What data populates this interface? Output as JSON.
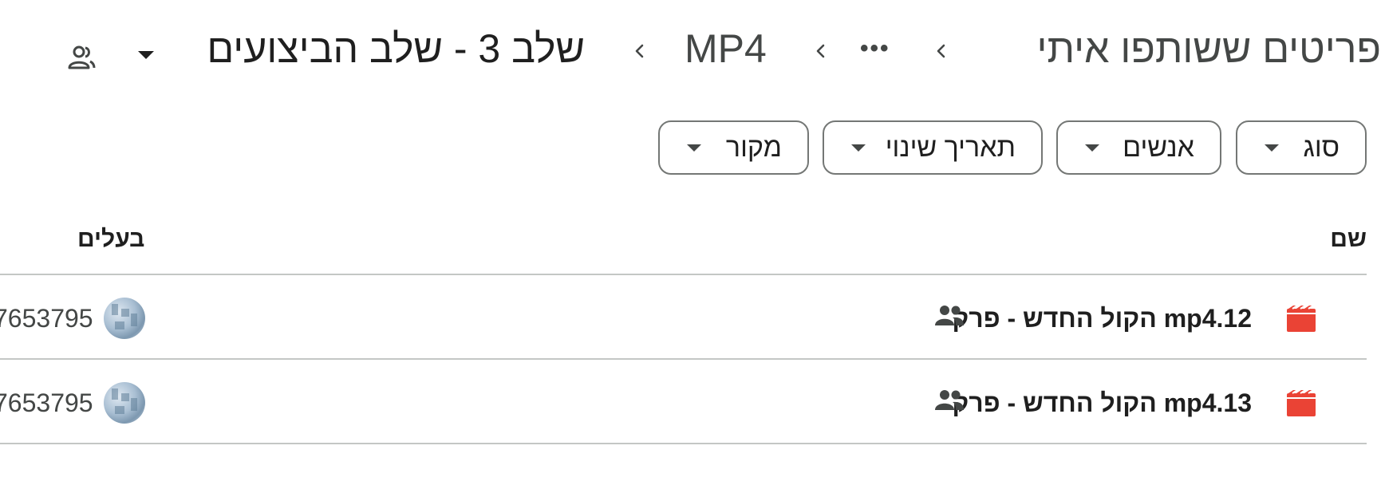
{
  "breadcrumb": {
    "root": "פריטים ששותפו איתי",
    "ellipsis": "•••",
    "folder": "MP4",
    "current": "שלב 3 - שלב הביצועים"
  },
  "filters": [
    {
      "label": "סוג"
    },
    {
      "label": "אנשים"
    },
    {
      "label": "תאריך שינוי"
    },
    {
      "label": "מקור"
    }
  ],
  "table": {
    "columns": {
      "name": "שם",
      "owner": "בעלים"
    },
    "rows": [
      {
        "name": "הקול החדש - פרק mp4.12",
        "owner": "7653795",
        "icon": "video-file-icon"
      },
      {
        "name": "הקול החדש - פרק mp4.13",
        "owner": "7653795",
        "icon": "video-file-icon"
      }
    ]
  },
  "colors": {
    "video_icon": "#ea4335",
    "border": "#747775",
    "divider": "#c4c7c5"
  }
}
